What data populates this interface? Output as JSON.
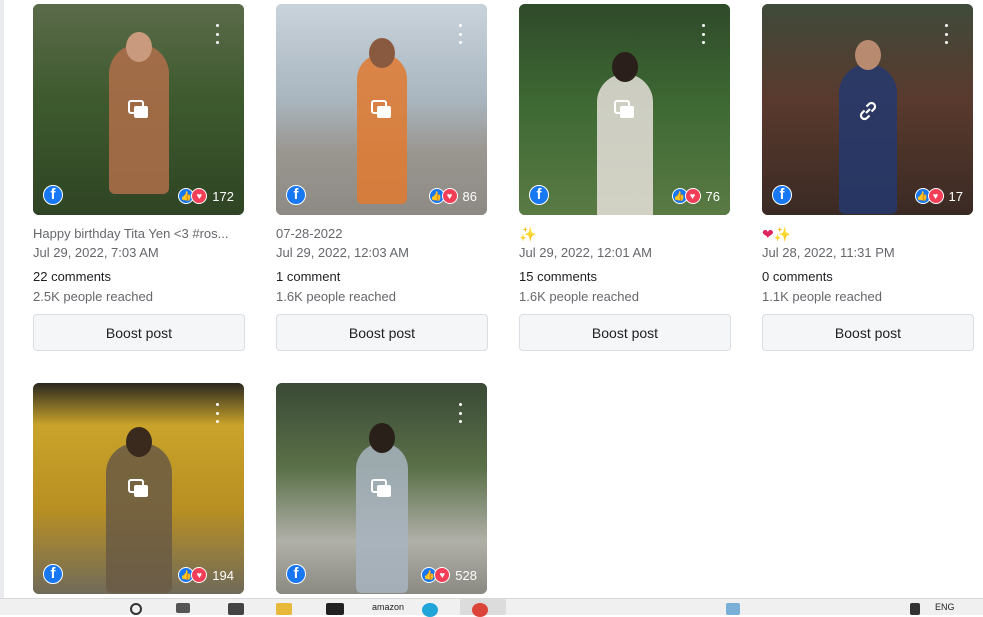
{
  "posts": [
    {
      "caption": "Happy birthday Tita Yen <3 #ros...",
      "date": "Jul 29, 2022, 7:03 AM",
      "reactions": "172",
      "comments": "22 comments",
      "reached": "2.5K people reached",
      "boost": "Boost post",
      "center_icon": "multi-photo-icon"
    },
    {
      "caption": "07-28-2022",
      "date": "Jul 29, 2022, 12:03 AM",
      "reactions": "86",
      "comments": "1 comment",
      "reached": "1.6K people reached",
      "boost": "Boost post",
      "center_icon": "multi-photo-icon"
    },
    {
      "caption": "✨",
      "date": "Jul 29, 2022, 12:01 AM",
      "reactions": "76",
      "comments": "15 comments",
      "reached": "1.6K people reached",
      "boost": "Boost post",
      "center_icon": "multi-photo-icon"
    },
    {
      "caption": "❤✨",
      "date": "Jul 28, 2022, 11:31 PM",
      "reactions": "17",
      "comments": "0 comments",
      "reached": "1.1K people reached",
      "boost": "Boost post",
      "center_icon": "link-icon"
    },
    {
      "reactions": "194",
      "center_icon": "multi-photo-icon"
    },
    {
      "reactions": "528",
      "center_icon": "multi-photo-icon"
    }
  ],
  "taskbar": {
    "amazon_label": "amazon",
    "tray_text": "ENG"
  },
  "colors": {
    "facebook_blue": "#1877f2",
    "love_red": "#f33e58",
    "muted_text": "#65676b",
    "button_bg": "#f5f6f7"
  }
}
